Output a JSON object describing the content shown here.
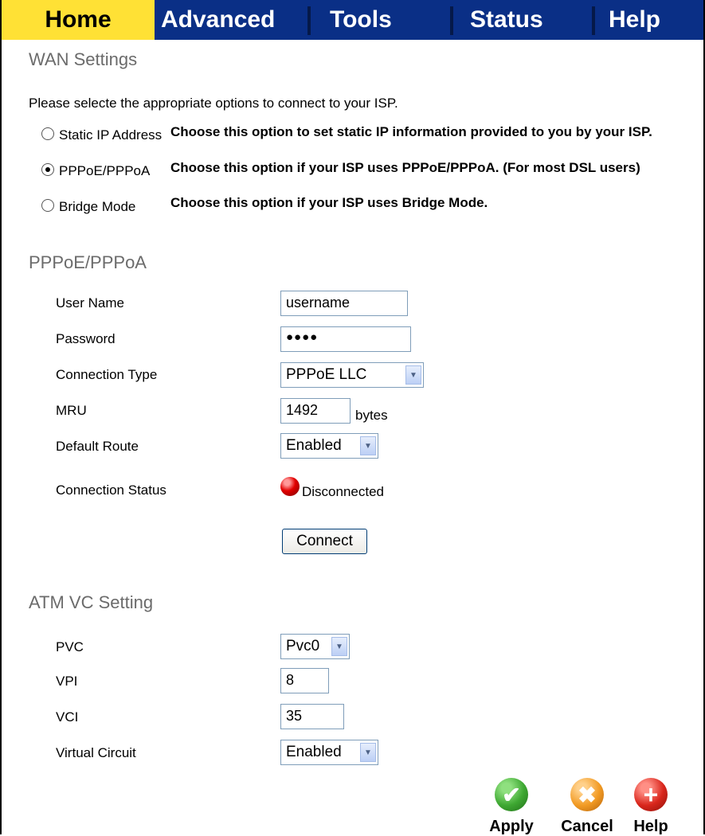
{
  "tabs": [
    {
      "label": "Home",
      "active": true
    },
    {
      "label": "Advanced",
      "active": false
    },
    {
      "label": "Tools",
      "active": false
    },
    {
      "label": "Status",
      "active": false
    },
    {
      "label": "Help",
      "active": false
    }
  ],
  "wan": {
    "title": "WAN Settings",
    "intro": "Please selecte the appropriate options to connect to your ISP.",
    "options": [
      {
        "label": "Static IP Address",
        "description": "Choose this option to set static IP information provided to you by your ISP.",
        "selected": false
      },
      {
        "label": "PPPoE/PPPoA",
        "description": "Choose this option if your ISP uses PPPoE/PPPoA. (For most DSL users)",
        "selected": true
      },
      {
        "label": "Bridge Mode",
        "description": "Choose this option if your ISP uses Bridge Mode.",
        "selected": false
      }
    ]
  },
  "pppoe": {
    "title": "PPPoE/PPPoA",
    "user_name_label": "User Name",
    "user_name_value": "username",
    "password_label": "Password",
    "password_value": "●●●●",
    "connection_type_label": "Connection Type",
    "connection_type_value": "PPPoE LLC",
    "mru_label": "MRU",
    "mru_value": "1492",
    "mru_unit": "bytes",
    "default_route_label": "Default Route",
    "default_route_value": "Enabled",
    "connection_status_label": "Connection Status",
    "connection_status_value": "Disconnected",
    "connect_button": "Connect"
  },
  "atm": {
    "title": "ATM VC Setting",
    "pvc_label": "PVC",
    "pvc_value": "Pvc0",
    "vpi_label": "VPI",
    "vpi_value": "8",
    "vci_label": "VCI",
    "vci_value": "35",
    "virtual_circuit_label": "Virtual Circuit",
    "virtual_circuit_value": "Enabled"
  },
  "actions": {
    "apply": "Apply",
    "cancel": "Cancel",
    "help": "Help"
  },
  "colors": {
    "tab_bar": "#0a2f86",
    "active_tab": "#ffe135",
    "section_title": "#6b6b6b",
    "apply_icon": "#3ea832",
    "cancel_icon": "#f29b24",
    "help_icon": "#d9261c",
    "status_led": "#e20000"
  }
}
